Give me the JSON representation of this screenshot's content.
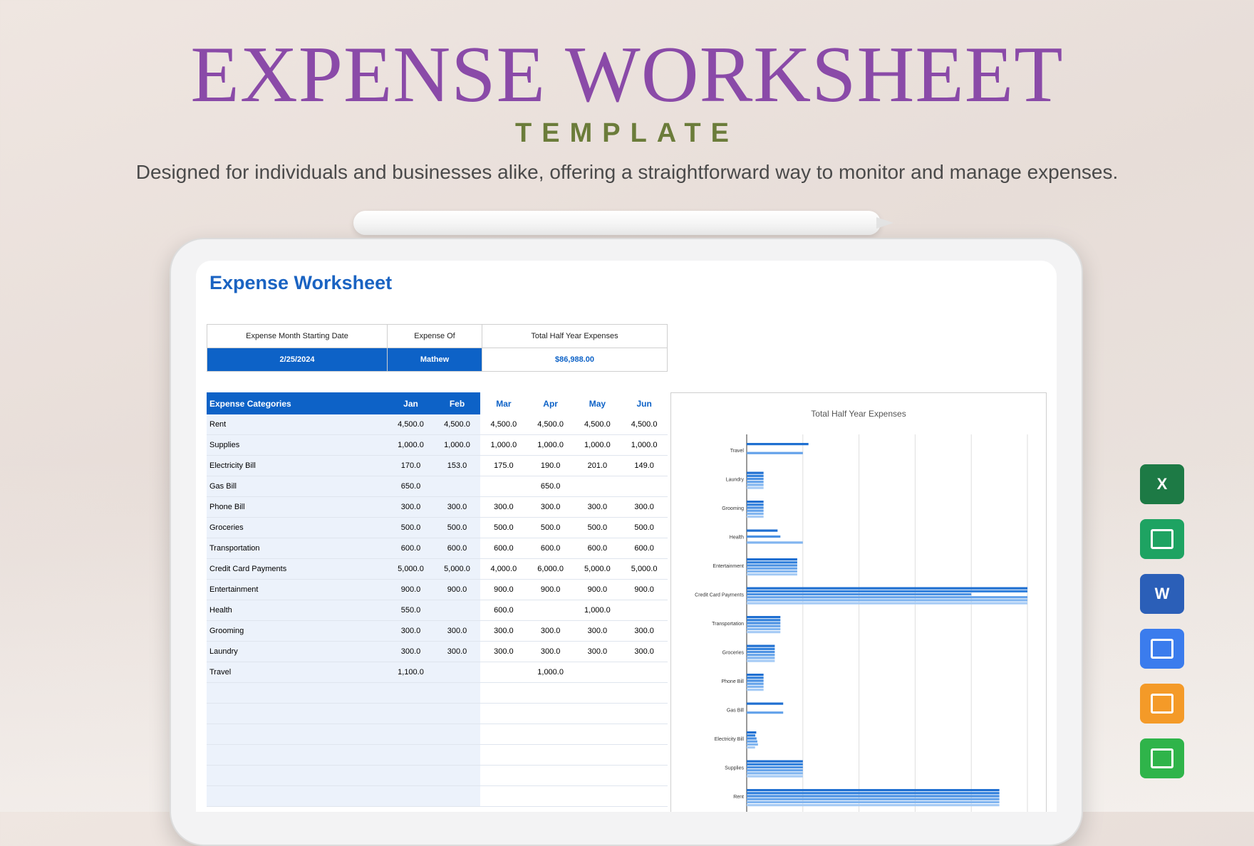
{
  "hero": {
    "title": "EXPENSE WORKSHEET",
    "subtitle": "TEMPLATE",
    "description": "Designed for individuals and businesses alike, offering a straightforward way to monitor and manage expenses."
  },
  "worksheet": {
    "title": "Expense Worksheet",
    "summary": {
      "headers": [
        "Expense Month Starting Date",
        "Expense Of",
        "Total Half Year Expenses"
      ],
      "values": [
        "2/25/2024",
        "Mathew",
        "$86,988.00"
      ]
    },
    "table": {
      "headers": [
        "Expense Categories",
        "Jan",
        "Feb",
        "Mar",
        "Apr",
        "May",
        "Jun"
      ],
      "rows": [
        [
          "Rent",
          "4,500.0",
          "4,500.0",
          "4,500.0",
          "4,500.0",
          "4,500.0",
          "4,500.0"
        ],
        [
          "Supplies",
          "1,000.0",
          "1,000.0",
          "1,000.0",
          "1,000.0",
          "1,000.0",
          "1,000.0"
        ],
        [
          "Electricity Bill",
          "170.0",
          "153.0",
          "175.0",
          "190.0",
          "201.0",
          "149.0"
        ],
        [
          "Gas Bill",
          "650.0",
          "",
          "",
          "650.0",
          "",
          ""
        ],
        [
          "Phone Bill",
          "300.0",
          "300.0",
          "300.0",
          "300.0",
          "300.0",
          "300.0"
        ],
        [
          "Groceries",
          "500.0",
          "500.0",
          "500.0",
          "500.0",
          "500.0",
          "500.0"
        ],
        [
          "Transportation",
          "600.0",
          "600.0",
          "600.0",
          "600.0",
          "600.0",
          "600.0"
        ],
        [
          "Credit Card Payments",
          "5,000.0",
          "5,000.0",
          "4,000.0",
          "6,000.0",
          "5,000.0",
          "5,000.0"
        ],
        [
          "Entertainment",
          "900.0",
          "900.0",
          "900.0",
          "900.0",
          "900.0",
          "900.0"
        ],
        [
          "Health",
          "550.0",
          "",
          "600.0",
          "",
          "1,000.0",
          ""
        ],
        [
          "Grooming",
          "300.0",
          "300.0",
          "300.0",
          "300.0",
          "300.0",
          "300.0"
        ],
        [
          "Laundry",
          "300.0",
          "300.0",
          "300.0",
          "300.0",
          "300.0",
          "300.0"
        ],
        [
          "Travel",
          "1,100.0",
          "",
          "",
          "1,000.0",
          "",
          ""
        ],
        [
          "",
          "",
          "",
          "",
          "",
          "",
          ""
        ],
        [
          "",
          "",
          "",
          "",
          "",
          "",
          ""
        ],
        [
          "",
          "",
          "",
          "",
          "",
          "",
          ""
        ],
        [
          "",
          "",
          "",
          "",
          "",
          "",
          ""
        ],
        [
          "",
          "",
          "",
          "",
          "",
          "",
          ""
        ],
        [
          "",
          "",
          "",
          "",
          "",
          "",
          ""
        ]
      ]
    }
  },
  "chart_data": {
    "type": "bar",
    "orientation": "horizontal",
    "title": "Total Half Year Expenses",
    "categories": [
      "Travel",
      "Laundry",
      "Grooming",
      "Health",
      "Entertainment",
      "Credit Card Payments",
      "Transportation",
      "Groceries",
      "Phone Bill",
      "Gas Bill",
      "Electricity Bill",
      "Supplies",
      "Rent"
    ],
    "series": [
      {
        "values": [
          1100,
          300,
          300,
          550,
          900,
          5000,
          600,
          500,
          300,
          650,
          170,
          1000,
          4500
        ]
      },
      {
        "values": [
          0,
          300,
          300,
          0,
          900,
          5000,
          600,
          500,
          300,
          0,
          153,
          1000,
          4500
        ]
      },
      {
        "values": [
          0,
          300,
          300,
          600,
          900,
          4000,
          600,
          500,
          300,
          0,
          175,
          1000,
          4500
        ]
      },
      {
        "values": [
          1000,
          300,
          300,
          0,
          900,
          6000,
          600,
          500,
          300,
          650,
          190,
          1000,
          4500
        ]
      },
      {
        "values": [
          0,
          300,
          300,
          1000,
          900,
          5000,
          600,
          500,
          300,
          0,
          201,
          1000,
          4500
        ]
      },
      {
        "values": [
          0,
          300,
          300,
          0,
          900,
          5000,
          600,
          500,
          300,
          0,
          149,
          1000,
          4500
        ]
      }
    ],
    "xlim": [
      0,
      5000
    ],
    "grid": true,
    "series_colors": [
      "#1f6fd1",
      "#2f7fdc",
      "#4a90e2",
      "#64a2ea",
      "#81b5f0",
      "#a6cbf5"
    ]
  },
  "apps": [
    {
      "name": "excel-icon",
      "letter": "X",
      "color": "#1d7a45"
    },
    {
      "name": "google-sheets-icon",
      "letter": "",
      "color": "#1ea362"
    },
    {
      "name": "word-icon",
      "letter": "W",
      "color": "#2b5fb8"
    },
    {
      "name": "google-docs-icon",
      "letter": "",
      "color": "#3b7ced"
    },
    {
      "name": "pages-icon",
      "letter": "",
      "color": "#f49a28"
    },
    {
      "name": "numbers-icon",
      "letter": "",
      "color": "#2fb44a"
    }
  ]
}
